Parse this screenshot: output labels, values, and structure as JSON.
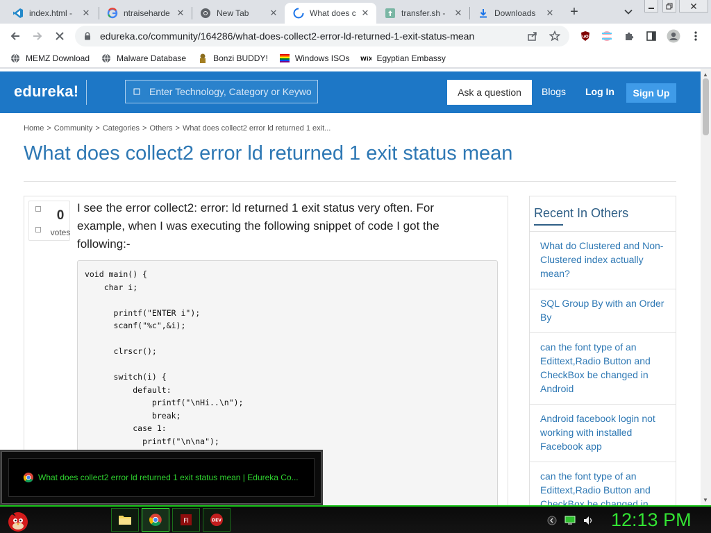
{
  "tabs": [
    {
      "title": "index.html -",
      "icon": "vscode-icon"
    },
    {
      "title": "ntraiseharde",
      "icon": "google-icon"
    },
    {
      "title": "New Tab",
      "icon": "chrome-icon"
    },
    {
      "title": "What does c",
      "icon": "loading-spinner-icon",
      "active": true
    },
    {
      "title": "transfer.sh -",
      "icon": "transfer-icon"
    },
    {
      "title": "Downloads",
      "icon": "download-icon"
    }
  ],
  "url": "edureka.co/community/164286/what-does-collect2-error-ld-returned-1-exit-status-mean",
  "bookmarks": [
    {
      "label": "MEMZ Download",
      "icon": "globe-icon"
    },
    {
      "label": "Malware Database",
      "icon": "globe-icon"
    },
    {
      "label": "Bonzi BUDDY!",
      "icon": "bonzi-icon"
    },
    {
      "label": "Windows ISOs",
      "icon": "windows-icon"
    },
    {
      "label": "Egyptian Embassy",
      "icon": "wix-icon"
    }
  ],
  "site": {
    "logo": "edureka!",
    "search_placeholder": "Enter Technology, Category or Keywo",
    "ask_label": "Ask a question",
    "blogs_label": "Blogs",
    "login_label": "Log In",
    "signup_label": "Sign Up"
  },
  "breadcrumb": [
    "Home",
    "Community",
    "Categories",
    "Others",
    "What does collect2 error ld returned 1 exit..."
  ],
  "breadcrumb_sep": ">",
  "page_title": "What does collect2 error ld returned 1 exit status mean",
  "question": {
    "votes": "0",
    "votes_label": "votes",
    "text": "I see the error collect2: error: ld returned 1 exit status very often. For example, when I was executing the following snippet of code I got the following:-",
    "code": "void main() {\n    char i;\n\n      printf(\"ENTER i\");\n      scanf(\"%c\",&i);\n\n      clrscr();\n\n      switch(i) {\n          default:\n              printf(\"\\nHi..\\n\");\n              break;\n          case 1:\n            printf(\"\\n\\na\");"
  },
  "sidebar": {
    "title": "Recent In Others",
    "items": [
      "What do Clustered and Non-Clustered index actually mean?",
      "SQL Group By with an Order By",
      "can the font type of an Edittext,Radio Button and CheckBox be changed in Android",
      "Android facebook login not working with installed Facebook app",
      "can the font type of an Edittext,Radio Button and CheckBox be changed in Android"
    ]
  },
  "taskbar": {
    "preview_title": "What does collect2 error ld returned 1 exit status mean | Edureka Co...",
    "clock": "12:13 PM",
    "accent": "#33e433"
  },
  "colors": {
    "header_blue": "#1d77c6",
    "title_blue": "#2e78b4"
  }
}
